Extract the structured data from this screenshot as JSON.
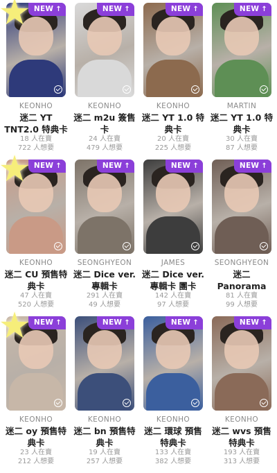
{
  "cards": [
    {
      "member": "KEONHO",
      "title": "迷二 YT TNT2.0 特典卡",
      "selling": "18 人在賣",
      "wanting": "722 人想要",
      "badge": "NEW",
      "star": true,
      "tone": "#2e3a7a"
    },
    {
      "member": "KEONHO",
      "title": "迷二 m2u 簽售卡",
      "selling": "24 人在賣",
      "wanting": "479 人想要",
      "badge": "NEW",
      "star": false,
      "tone": "#d9d9d9"
    },
    {
      "member": "KEONHO",
      "title": "迷二 YT 1.0 特典卡",
      "selling": "20 人在賣",
      "wanting": "225 人想要",
      "badge": "NEW",
      "star": false,
      "tone": "#8c6a4e"
    },
    {
      "member": "MARTIN",
      "title": "迷二 YT 1.0 特典卡",
      "selling": "30 人在賣",
      "wanting": "87 人想要",
      "badge": "NEW",
      "star": false,
      "tone": "#5e8f55"
    },
    {
      "member": "KEONHO",
      "title": "迷二 CU 預售特典卡",
      "selling": "47 人在賣",
      "wanting": "520 人想要",
      "badge": "NEW",
      "star": true,
      "tone": "#c99a86"
    },
    {
      "member": "SEONGHYEON",
      "title": "迷二 Dice ver. 專輯卡",
      "selling": "291 人在賣",
      "wanting": "49 人想要",
      "badge": "NEW",
      "star": false,
      "tone": "#7d7368"
    },
    {
      "member": "JAMES",
      "title": "迷二 Dice ver. 專輯卡 團卡",
      "selling": "142 人在賣",
      "wanting": "97 人想要",
      "badge": "NEW",
      "star": false,
      "tone": "#3d3d3d"
    },
    {
      "member": "SEONGHYEON",
      "title": "迷二 Panorama A...",
      "selling": "81 人在賣",
      "wanting": "99 人想要",
      "badge": "NEW",
      "star": false,
      "tone": "#6f5e55"
    },
    {
      "member": "KEONHO",
      "title": "迷二 oy 預售特典卡",
      "selling": "23 人在賣",
      "wanting": "212 人想要",
      "badge": "NEW",
      "star": true,
      "tone": "#c7b7a8"
    },
    {
      "member": "KEONHO",
      "title": "迷二 bn 預售特典卡",
      "selling": "19 人在賣",
      "wanting": "257 人想要",
      "badge": "NEW",
      "star": false,
      "tone": "#3c4f7a"
    },
    {
      "member": "KEONHO",
      "title": "迷二 環球 預售特典卡",
      "selling": "133 人在賣",
      "wanting": "382 人想要",
      "badge": "NEW",
      "star": false,
      "tone": "#3b5f9e"
    },
    {
      "member": "KEONHO",
      "title": "迷二 wvs 預售特典卡",
      "selling": "193 人在賣",
      "wanting": "313 人想要",
      "badge": "NEW",
      "star": false,
      "tone": "#8a6a58"
    }
  ],
  "icons": {
    "badge_arrow": "arrow-up-icon",
    "check": "check-circle-icon",
    "star": "star-sticker-icon"
  }
}
